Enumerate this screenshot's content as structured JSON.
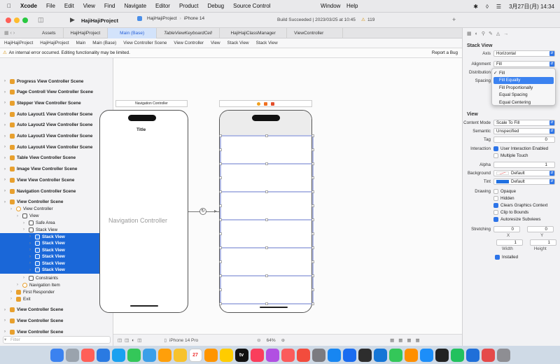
{
  "menubar": {
    "app": "Xcode",
    "items": [
      "File",
      "Edit",
      "View",
      "Find",
      "Navigate",
      "Editor",
      "Product",
      "Debug",
      "Source Control"
    ],
    "window": "Window",
    "help": "Help",
    "clock": "3月27日(月)  14:34"
  },
  "toolbar": {
    "project": "HajiHajiProject",
    "scheme": "HajiHajiProject",
    "device": "iPhone 14",
    "status": "Build Succeeded | 2023/03/25 at 10:45",
    "warnings": "119"
  },
  "tabs": [
    "Assets",
    "HajiHajiProject",
    "Main (Base)",
    "TableViewKeyboardCell",
    "HajiHajiClassManager",
    "ViewController"
  ],
  "jumpbar": [
    "HajiHajiProject",
    "HajiHajiProject",
    "Main",
    "Main (Base)",
    "View Controller Scene",
    "View Controller",
    "View",
    "Stack View",
    "Stack View"
  ],
  "warning": {
    "text": "An internal error occurred. Editing functionality may be limited.",
    "action": "Report a Bug"
  },
  "navigator": {
    "scenes_top": [
      "Progress View Controller Scene",
      "Page Controll View Controller Scene",
      "Stepper View Controller Scene",
      "Auto Layout1 View Controller Scene",
      "Auto Layout2 View Controller Scene",
      "Auto Layout3 View Controller Scene",
      "Auto Layout4 View Controller Scene",
      "Table View Controller Scene",
      "Image View Controller Scene",
      "View View Controller Scene",
      "Navigation Controller Scene",
      "View Controller Scene"
    ],
    "tree": [
      "View Controller",
      "View",
      "Safe Area",
      "Stack View"
    ],
    "stack_children": [
      "Stack View",
      "Stack View",
      "Stack View",
      "Stack View",
      "Stack View",
      "Stack View"
    ],
    "tree_after": [
      "Constraints",
      "Navigation Item",
      "First Responder",
      "Exit"
    ],
    "scenes_bottom": [
      "View Controller Scene",
      "View Controller Scene",
      "View Controller Scene"
    ],
    "filter_placeholder": "Filter"
  },
  "canvas": {
    "nav_title": "Navigation Controller",
    "nav_scene_text": "Navigation Controller",
    "phone_title": "Title",
    "stack_row_count": 6,
    "device_label": "iPhone 14 Pro",
    "zoom": "64%"
  },
  "inspector": {
    "section_stack": "Stack View",
    "axis_label": "Axis",
    "axis_value": "Horizontal",
    "alignment_label": "Alignment",
    "alignment_value": "Fill",
    "distribution_label": "Distribution",
    "spacing_label": "Spacing",
    "section_view": "View",
    "content_mode_label": "Content Mode",
    "content_mode_value": "Scale To Fill",
    "semantic_label": "Semantic",
    "semantic_value": "Unspecified",
    "tag_label": "Tag",
    "tag_value": "0",
    "interaction_label": "Interaction",
    "user_interaction": "User Interaction Enabled",
    "multiple_touch": "Multiple Touch",
    "alpha_label": "Alpha",
    "alpha_value": "1",
    "background_label": "Background",
    "background_value": "Default",
    "tint_label": "Tint",
    "tint_value": "Default",
    "drawing_label": "Drawing",
    "opaque": "Opaque",
    "hidden": "Hidden",
    "clears": "Clears Graphics Context",
    "clip": "Clip to Bounds",
    "autoresize": "Autoresize Subviews",
    "stretching_label": "Stretching",
    "stretch_x": "0",
    "stretch_y": "0",
    "x_label": "X",
    "y_label": "Y",
    "stretch_w": "1",
    "stretch_h": "1",
    "width_label": "Width",
    "height_label": "Height",
    "installed": "Installed"
  },
  "dropdown": [
    "Fill",
    "Fill Equally",
    "Fill Proportionally",
    "Equal Spacing",
    "Equal Centering"
  ],
  "dock": [
    {
      "color": "#3b82f0"
    },
    {
      "color": "#9aa3ad"
    },
    {
      "color": "#ff5f57"
    },
    {
      "color": "#2a7ae2"
    },
    {
      "color": "#19a1f0"
    },
    {
      "color": "#34c759"
    },
    {
      "color": "#3b9fe8"
    },
    {
      "color": "#ff9f0a"
    },
    {
      "color": "#f7c22d"
    },
    {
      "color": "#ffffff"
    },
    {
      "color": "#ff9500"
    },
    {
      "color": "#ffcc00"
    },
    {
      "color": "#111111"
    },
    {
      "color": "#fa3e5c"
    },
    {
      "color": "#b150e2"
    },
    {
      "color": "#fb5b5b"
    },
    {
      "color": "#f24c3d"
    },
    {
      "color": "#7b7b80"
    },
    {
      "color": "#1786f2"
    },
    {
      "color": "#1a6cf0"
    },
    {
      "color": "#2d2d2d"
    },
    {
      "color": "#1576d6"
    },
    {
      "color": "#34c759"
    },
    {
      "color": "#ff8f00"
    },
    {
      "color": "#1c8ef9"
    },
    {
      "color": "#222222"
    },
    {
      "color": "#22c15e"
    },
    {
      "color": "#1f6fd9"
    },
    {
      "color": "#e54a4a"
    },
    {
      "color": "#8e8e93"
    }
  ],
  "dock_labels": {
    "calendar_day": "27",
    "tv": "tv"
  }
}
